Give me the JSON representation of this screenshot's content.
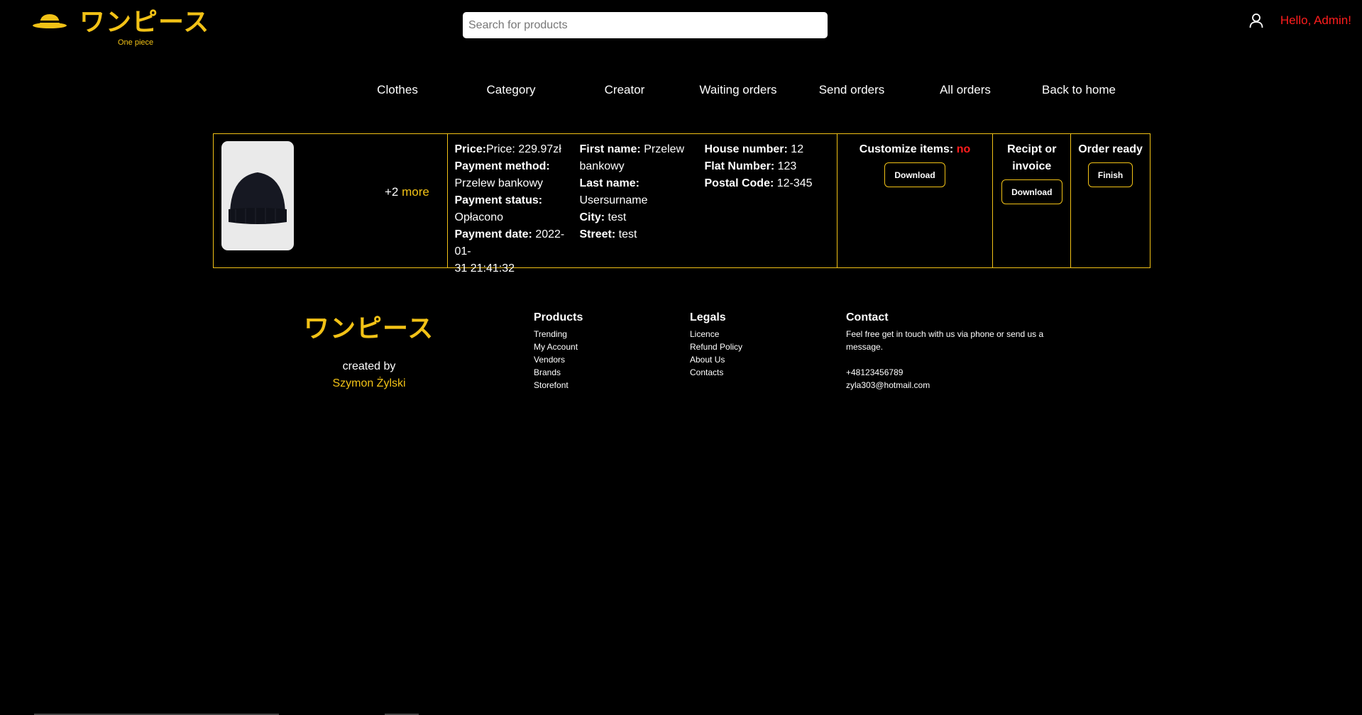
{
  "header": {
    "logo_jp": "ワンピース",
    "logo_sub": "One piece",
    "search_placeholder": "Search for products",
    "greeting": "Hello, Admin!"
  },
  "nav": [
    "Clothes",
    "Category",
    "Creator",
    "Waiting orders",
    "Send orders",
    "All orders",
    "Back to home"
  ],
  "order": {
    "more_count": "+2",
    "more_label": "more",
    "price_label": "Price:",
    "price_value": "Price: 229.97zł",
    "payment_method_label": "Payment method:",
    "payment_method_value": "Przelew bankowy",
    "payment_status_label": "Payment status:",
    "payment_status_value": "Opłacono",
    "payment_date_label": "Payment date:",
    "payment_date_value_1": "2022-01-",
    "payment_date_value_2": "31 21:41:32",
    "first_name_label": "First name:",
    "first_name_value_1": "Przelew",
    "first_name_value_2": "bankowy",
    "last_name_label": "Last name:",
    "last_name_value": "Usersurname",
    "city_label": "City:",
    "city_value": "test",
    "street_label": "Street:",
    "street_value": "test",
    "house_label": "House number:",
    "house_value": "12",
    "flat_label": "Flat Number:",
    "flat_value": "123",
    "postal_label": "Postal Code:",
    "postal_value": "12-345",
    "customize_label": "Customize items:",
    "customize_value": "no",
    "customize_button": "Download",
    "receipt_label_1": "Recipt or",
    "receipt_label_2": "invoice",
    "receipt_button": "Download",
    "ready_label": "Order ready",
    "ready_button": "Finish"
  },
  "footer": {
    "logo_jp": "ワンピース",
    "created_by": "created by",
    "author": "Szymon Żylski",
    "products": {
      "title": "Products",
      "items": [
        "Trending",
        "My Account",
        "Vendors",
        "Brands",
        "Storefont"
      ]
    },
    "legals": {
      "title": "Legals",
      "items": [
        "Licence",
        "Refund Policy",
        "About Us",
        "Contacts"
      ]
    },
    "contact": {
      "title": "Contact",
      "text_1": "Feel free get in touch with us via phone or send us a",
      "text_2": "message.",
      "phone": "+48123456789",
      "email": "zyla303@hotmail.com"
    }
  },
  "colors": {
    "accent": "#f2c216",
    "alert": "#ff1d1d",
    "background": "#000000"
  }
}
